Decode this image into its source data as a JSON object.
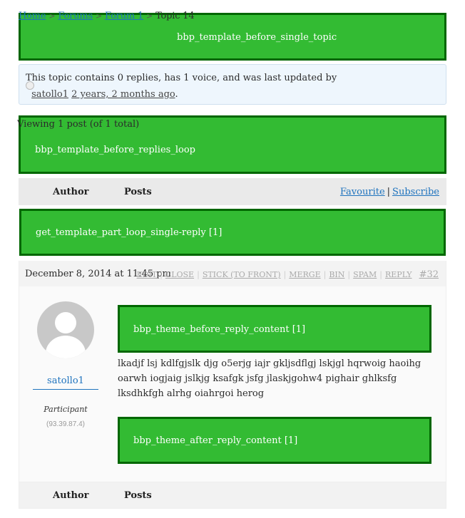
{
  "breadcrumb": {
    "items": [
      "Home",
      "Forums",
      "Forum 1"
    ],
    "current": "Topic 14",
    "separator": ">"
  },
  "hooks": {
    "before_single_topic": "bbp_template_before_single_topic",
    "before_replies_loop": "bbp_template_before_replies_loop",
    "loop_single_reply": "get_template_part_loop_single-reply [1]",
    "before_reply_content": "bbp_theme_before_reply_content [1]",
    "after_reply_content": "bbp_theme_after_reply_content [1]"
  },
  "topic_info": {
    "text": "This topic contains 0 replies, has 1 voice, and was last updated by",
    "user": "satollo1",
    "freshness": "2 years, 2 months ago",
    "end": "."
  },
  "pagination": {
    "count_text": "Viewing 1 post (of 1 total)"
  },
  "table_header": {
    "author": "Author",
    "posts": "Posts",
    "favourite": "Favourite",
    "separator": "|",
    "subscribe": "Subscribe"
  },
  "reply": {
    "date": "December 8, 2014 at 11:45 pm",
    "admin_links": [
      "EDIT",
      "CLOSE",
      "STICK (TO FRONT)",
      "MERGE",
      "BIN",
      "SPAM",
      "REPLY"
    ],
    "permalink": "#32",
    "author": {
      "name": "satollo1",
      "role": "Participant",
      "ip": "(93.39.87.4)",
      "avatar_icon": "default-avatar-icon"
    },
    "content": "lkadjf lsj kdlfgjslk djg o5erjg iajr gkljsdflgj lskjgl hqrwoig haoihg oarwh iogjaig jslkjg ksafgk jsfg jlaskjgohw4 pighair ghlksfg lksdhkfgh alrhg oiahrgoi herog"
  },
  "table_footer": {
    "author": "Author",
    "posts": "Posts"
  },
  "colors": {
    "hook_fill": "#33bb33",
    "hook_border": "#006600",
    "link": "#1e73be",
    "info_bg": "#eef6fd"
  }
}
